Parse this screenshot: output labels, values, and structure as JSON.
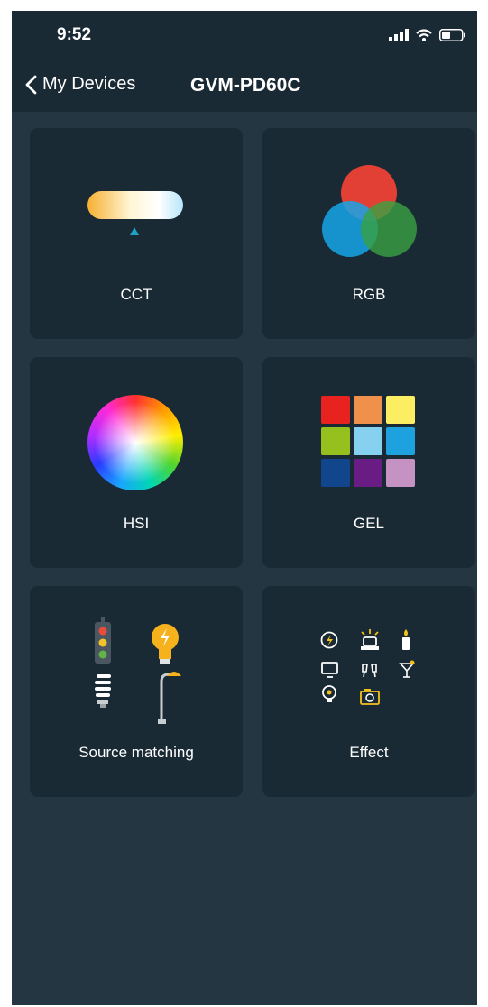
{
  "status_bar": {
    "time": "9:52",
    "icons": [
      "signal-icon",
      "wifi-icon",
      "battery-icon"
    ]
  },
  "nav": {
    "back_label": "My Devices",
    "title": "GVM-PD60C"
  },
  "tiles": [
    {
      "id": "cct",
      "label": "CCT",
      "icon": "cct-light-bar-icon"
    },
    {
      "id": "rgb",
      "label": "RGB",
      "icon": "rgb-circles-icon"
    },
    {
      "id": "hsi",
      "label": "HSI",
      "icon": "color-wheel-icon"
    },
    {
      "id": "gel",
      "label": "GEL",
      "icon": "gel-grid-icon"
    },
    {
      "id": "source",
      "label": "Source matching",
      "icon": "source-matching-icon"
    },
    {
      "id": "effect",
      "label": "Effect",
      "icon": "effect-icons"
    }
  ],
  "colors": {
    "background": "#243641",
    "tile": "#1a2a35",
    "text": "#ffffff",
    "accent": "#1fa3c4"
  }
}
